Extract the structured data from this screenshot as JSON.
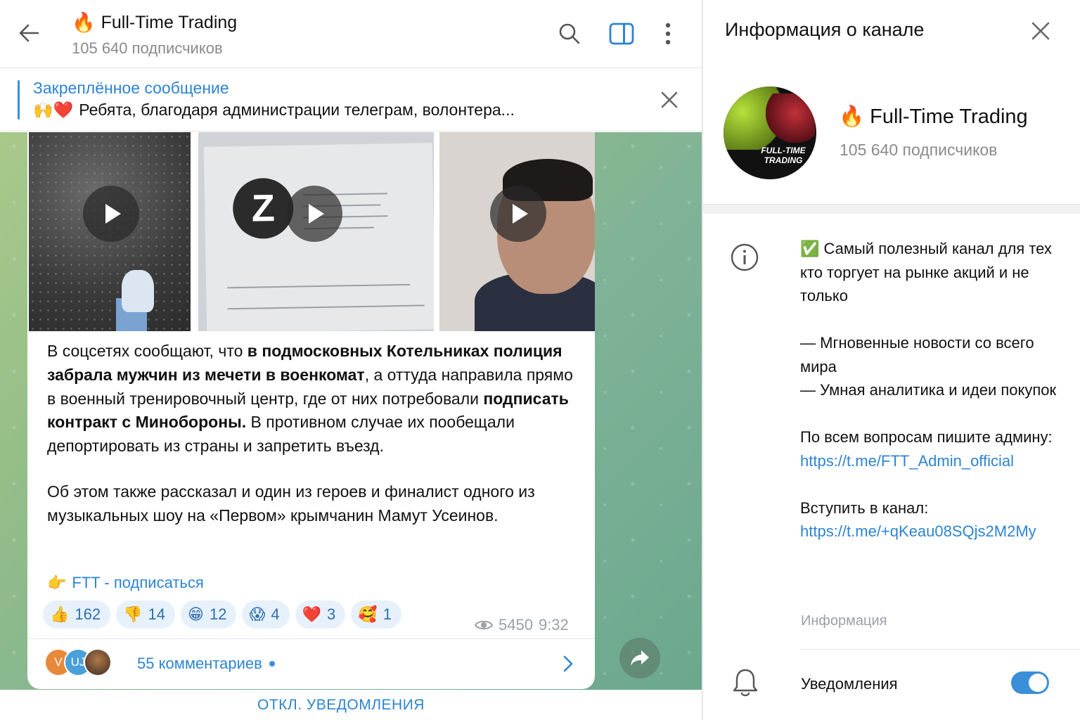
{
  "header": {
    "channel_fire": "🔥",
    "channel_name": "Full-Time Trading",
    "subscribers": "105 640 подписчиков",
    "icons": [
      "back-arrow-icon",
      "search-icon",
      "sidebar-panel-icon",
      "more-vertical-icon"
    ]
  },
  "pinned": {
    "title": "Закреплённое сообщение",
    "emojis": "🙌❤️",
    "text": "Ребята, благодаря администрации телеграм, волонтера..."
  },
  "post": {
    "media": [
      {
        "type": "video",
        "desc": "asphalt-walk"
      },
      {
        "type": "video",
        "desc": "document-z"
      },
      {
        "type": "video",
        "desc": "selfie"
      }
    ],
    "text_p1_a": "В соцсетях сообщают, что ",
    "text_p1_b": "в подмосковных Котельниках полиция забрала мужчин из мечети в военкомат",
    "text_p1_c": ", а оттуда направила прямо в военный тренировочный центр, где от них потребовали ",
    "text_p1_d": "подписать контракт с Минобороны.",
    "text_p1_e": " В противном случае их пообещали депортировать из страны и запретить въезд.",
    "text_p2": "Об этом также рассказал и один из героев и финалист одного из музыкальных шоу на «Первом» крымчанин Мамут Усеинов.",
    "subscribe_emoji": "👉",
    "subscribe_link": "FTT - подписаться",
    "reactions": [
      {
        "emoji": "👍",
        "count": "162"
      },
      {
        "emoji": "👎",
        "count": "14"
      },
      {
        "emoji": "😁",
        "count": "12"
      },
      {
        "emoji": "😱",
        "count": "4"
      },
      {
        "emoji": "❤️",
        "count": "3"
      },
      {
        "emoji": "🥰",
        "count": "1"
      }
    ],
    "views": "5450",
    "time": "9:32",
    "comment_avatars": [
      {
        "initials": "V",
        "color": "#e8893a"
      },
      {
        "initials": "UJ",
        "color": "#4aa0d8"
      },
      {
        "initials": "",
        "color": "#7a5a3e"
      }
    ],
    "comments": "55 комментариев"
  },
  "footer": {
    "mute_label": "ОТКЛ. УВЕДОМЛЕНИЯ"
  },
  "info_panel": {
    "title": "Информация о канале",
    "channel_fire": "🔥",
    "channel_name": "Full-Time Trading",
    "subscribers": "105 640 подписчиков",
    "avatar_text": "FULL-TIME TRADING",
    "desc_check": "✅",
    "desc_1": "Самый полезный канал для тех кто торгует на рынке акций и не только",
    "desc_2a": "— Мгновенные новости со всего мира",
    "desc_2b": "— Умная аналитика и идеи покупок",
    "desc_3": "По всем вопросам пишите админу:",
    "admin_link": "https://t.me/FTT_Admin_official",
    "desc_4": "Вступить в канал:",
    "join_link": "https://t.me/+qKeau08SQjs2M2My",
    "info_label": "Информация",
    "notifications_label": "Уведомления",
    "notifications_on": true
  }
}
